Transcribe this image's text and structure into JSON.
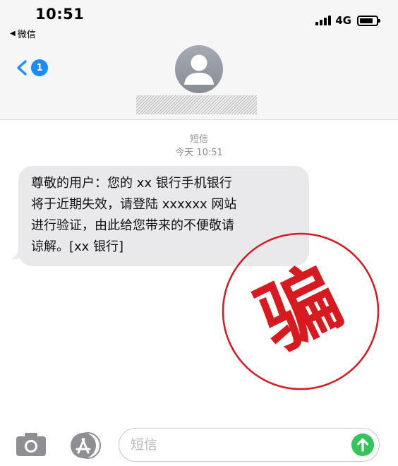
{
  "status_bar": {
    "time": "10:51",
    "back_app": "微信",
    "network": "4G"
  },
  "nav": {
    "unread_count": "1"
  },
  "conversation": {
    "service_label": "短信",
    "timestamp": "今天 10:51",
    "messages": [
      {
        "direction": "incoming",
        "lines": [
          "尊敬的用户：您的 xx 银行手机银行",
          "将于近期失效，请登陆 xxxxxx 网站",
          "进行验证，由此给您带来的不便敬请",
          "谅解。[xx 银行]"
        ]
      }
    ]
  },
  "stamp": {
    "text": "骗",
    "color": "#d71920"
  },
  "composer": {
    "placeholder": "短信"
  },
  "colors": {
    "accent": "#1a8cff",
    "send": "#35c35a",
    "bubble": "#e9e9eb",
    "header_bg": "#f6f6f6"
  },
  "icons": {
    "back": "chevron-left-icon",
    "contact": "person-avatar-icon",
    "camera": "camera-icon",
    "apps": "app-store-icon",
    "send": "arrow-up-icon"
  }
}
